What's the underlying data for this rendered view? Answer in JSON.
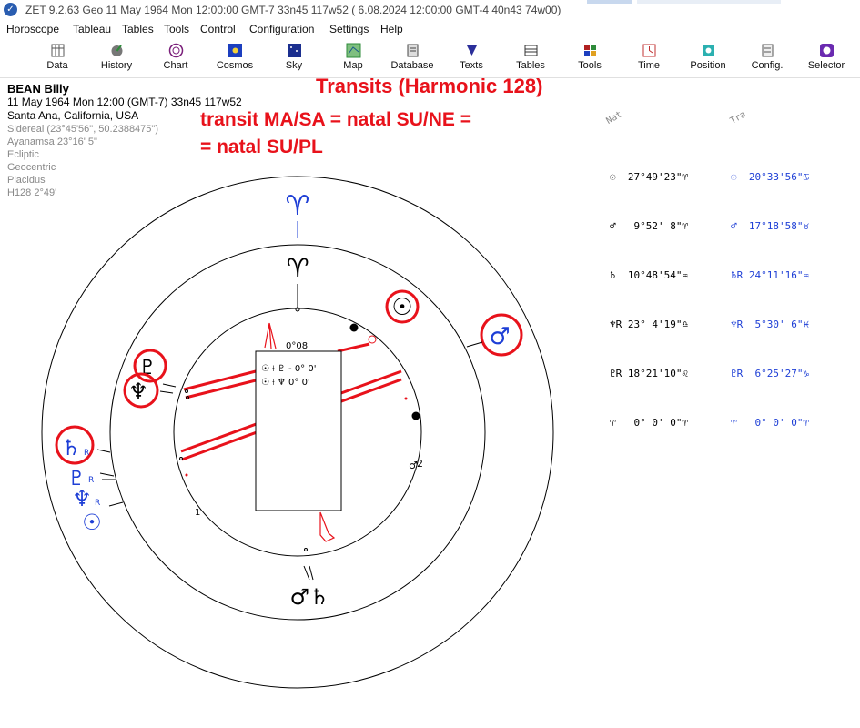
{
  "titlebar": {
    "text": "ZET 9.2.63 Geo   11 May 1964  Mon  12:00:00 GMT-7 33n45  117w52  ( 6.08.2024  12:00:00 GMT-4 40n43 74w00)"
  },
  "menu": [
    "Horoscope",
    "Tableau",
    "Tables",
    "Tools",
    "Control",
    "Configuration",
    "Settings",
    "Help"
  ],
  "toolbar": [
    {
      "label": "Data",
      "icon": "data-icon",
      "color": "#555"
    },
    {
      "label": "History",
      "icon": "history-icon",
      "color": "#333"
    },
    {
      "label": "Chart",
      "icon": "chart-icon",
      "color": "#7a1f7a"
    },
    {
      "label": "Cosmos",
      "icon": "cosmos-icon",
      "color": "#1c3fbf"
    },
    {
      "label": "Sky",
      "icon": "sky-icon",
      "color": "#1b2f8f"
    },
    {
      "label": "Map",
      "icon": "map-icon",
      "color": "#2e8b3a"
    },
    {
      "label": "Database",
      "icon": "database-icon",
      "color": "#444"
    },
    {
      "label": "Texts",
      "icon": "texts-icon",
      "color": "#2b2f9a"
    },
    {
      "label": "Tables",
      "icon": "tables-icon",
      "color": "#333"
    },
    {
      "label": "Tools",
      "icon": "tools-icon",
      "color": "#b02020"
    },
    {
      "label": "Time",
      "icon": "time-icon",
      "color": "#c03030"
    },
    {
      "label": "Position",
      "icon": "position-icon",
      "color": "#1a8a8a"
    },
    {
      "label": "Config.",
      "icon": "config-icon",
      "color": "#555"
    },
    {
      "label": "Selector",
      "icon": "selector-icon",
      "color": "#6a2ab0"
    }
  ],
  "person": {
    "name": "BEAN Billy",
    "datetime": "11 May 1964  Mon  12:00 (GMT-7) 33n45  117w52",
    "place": "Santa Ana, California, USA",
    "settings": [
      "Sidereal (23°45'56\", 50.2388475\")",
      "Ayanamsa 23°16' 5\"",
      "Ecliptic",
      "Geocentric",
      "Placidus",
      "H128   2°49'"
    ]
  },
  "annotations": {
    "title": "Transits (Harmonic 128)",
    "line1": "transit MA/SA = natal SU/NE =",
    "line2": "= natal SU/PL"
  },
  "positions": {
    "nat_header": "Nat",
    "tra_header": "Tra",
    "natal": [
      {
        "glyph": "☉",
        "value": "27°49'23\"",
        "sign": "♈"
      },
      {
        "glyph": "♂",
        "value": " 9°52' 8\"",
        "sign": "♈"
      },
      {
        "glyph": "♄",
        "value": "10°48'54\"",
        "sign": "♒"
      },
      {
        "glyph": "♆R",
        "value": "23° 4'19\"",
        "sign": "♎"
      },
      {
        "glyph": "♇R",
        "value": "18°21'10\"",
        "sign": "♌"
      },
      {
        "glyph": "♈",
        "value": " 0° 0' 0\"",
        "sign": "♈"
      }
    ],
    "transit": [
      {
        "glyph": "☉",
        "value": "20°33'56\"",
        "sign": "♋"
      },
      {
        "glyph": "♂",
        "value": "17°18'58\"",
        "sign": "♉"
      },
      {
        "glyph": "♄R",
        "value": "24°11'16\"",
        "sign": "♒"
      },
      {
        "glyph": "♆R",
        "value": " 5°30' 6\"",
        "sign": "♓"
      },
      {
        "glyph": "♇R",
        "value": " 6°25'27\"",
        "sign": "♑"
      },
      {
        "glyph": "♈",
        "value": " 0° 0' 0\"",
        "sign": "♈"
      }
    ]
  },
  "wheel": {
    "orb_label": "0°08'",
    "aspect_box": [
      "☉ ⟊ ♇ - 0° 0'",
      "☉ ⟊ ♆   0° 0'"
    ],
    "cusp_label_2": "2",
    "cusp_label_1": "1",
    "aries_outer": "♈",
    "aries_inner": "♈",
    "natal_glyphs": [
      "♇",
      "♆"
    ],
    "transit_glyphs": [
      "♄",
      "♇",
      "♆",
      "☉"
    ],
    "mars_saturn": "♂♄",
    "retro_mark": "R",
    "transit_sun": "☉",
    "transit_mars": "♂",
    "colors": {
      "accent": "#e8121b",
      "transit": "#1e3fd6",
      "natal": "#000000"
    }
  }
}
